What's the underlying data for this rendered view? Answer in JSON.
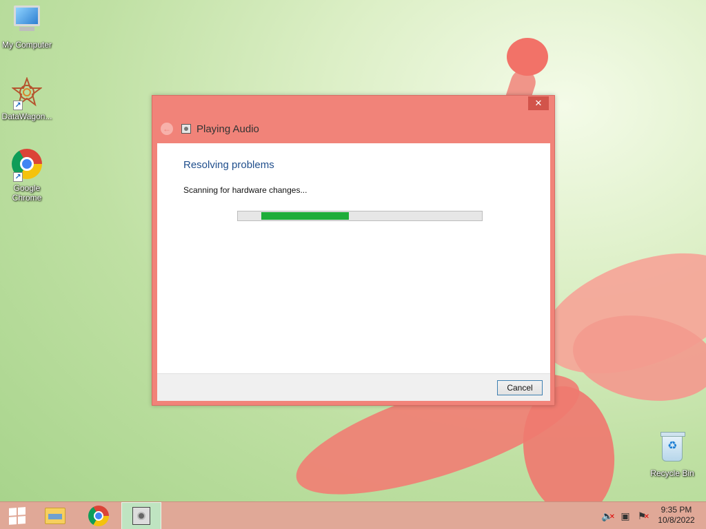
{
  "desktop": {
    "icons": [
      {
        "label": "My Computer",
        "icon": "computer-icon"
      },
      {
        "label": "DataWagon...",
        "icon": "datawagon-icon"
      },
      {
        "label": "Google Chrome",
        "icon": "chrome-icon"
      },
      {
        "label": "Recycle Bin",
        "icon": "recycle-bin-icon"
      }
    ]
  },
  "dialog": {
    "title": "Playing Audio",
    "close_label": "✕",
    "back_label": "←",
    "heading": "Resolving problems",
    "status": "Scanning for hardware changes...",
    "progress": 0.36,
    "cancel_label": "Cancel",
    "accent_color": "#f18379",
    "heading_color": "#1f4e8c",
    "progress_color": "#1fad3a"
  },
  "taskbar": {
    "items": [
      "start-button",
      "file-explorer",
      "google-chrome",
      "troubleshooter"
    ],
    "active_item": "troubleshooter",
    "clock_time": "9:35 PM",
    "clock_date": "10/8/2022",
    "tray_icons": [
      "volume-muted-icon",
      "network-icon",
      "action-center-flag-icon"
    ]
  }
}
